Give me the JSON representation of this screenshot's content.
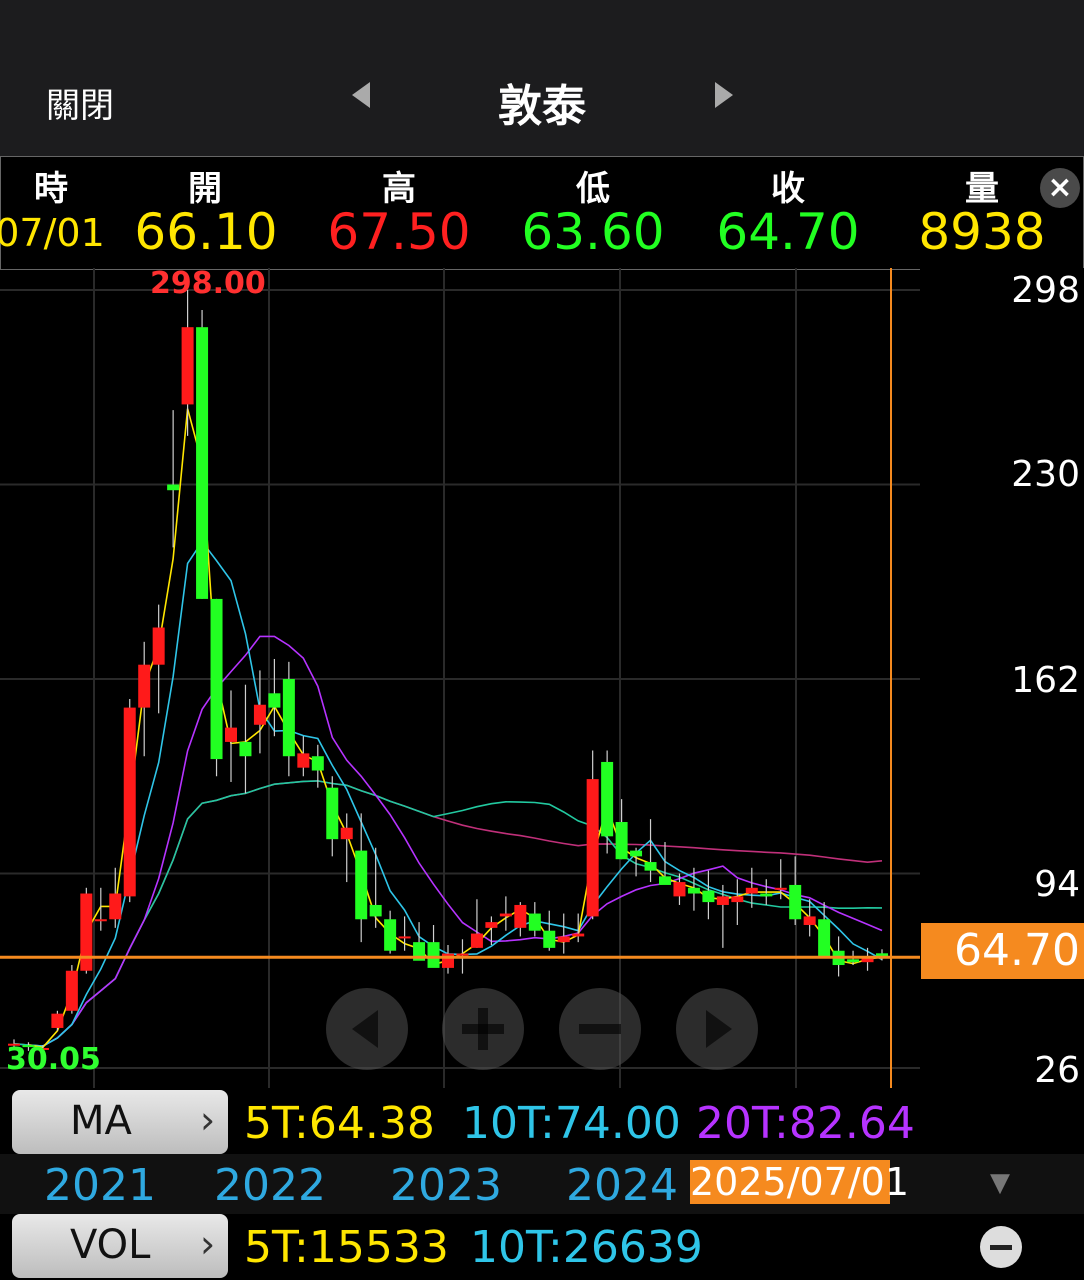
{
  "header": {
    "close_label": "關閉",
    "title": "敦泰"
  },
  "quote": {
    "headers": [
      "時",
      "開",
      "高",
      "低",
      "收",
      "量"
    ],
    "date": "07/01",
    "open": "66.10",
    "high": "67.50",
    "low": "63.60",
    "close": "64.70",
    "volume": "8938"
  },
  "chart_data": {
    "type": "candlestick",
    "ylim": [
      26,
      298
    ],
    "y_ticks": [
      "298",
      "230",
      "162",
      "94",
      "26"
    ],
    "max_label": "298.00",
    "min_label": "30.05",
    "current_price_label": "64.70",
    "x_labels": [
      "2021",
      "2022",
      "2023",
      "2024"
    ],
    "cursor_date": "2025/07/01",
    "colors": {
      "up": "#ff1a1a",
      "down": "#22ff22",
      "ma5": "#ffe600",
      "ma10": "#2fc5e8",
      "ma20": "#b633ff",
      "ma60": "#22c9a0",
      "ma120": "#c0307a",
      "cursor": "#f58a1f"
    },
    "candles": [
      [
        34,
        36,
        33,
        34.5
      ],
      [
        34,
        35,
        32,
        33.5
      ],
      [
        33,
        34,
        31,
        33
      ],
      [
        40,
        46,
        39,
        45
      ],
      [
        46,
        62,
        45,
        60
      ],
      [
        60,
        89,
        59,
        87
      ],
      [
        78,
        89,
        74,
        78
      ],
      [
        78,
        96,
        75,
        87
      ],
      [
        86,
        155,
        84,
        152
      ],
      [
        152,
        175,
        135,
        167
      ],
      [
        167,
        188,
        150,
        180
      ],
      [
        230,
        256,
        208,
        228
      ],
      [
        258,
        298,
        247,
        285
      ],
      [
        285,
        291,
        190,
        190
      ],
      [
        190,
        190,
        128,
        134
      ],
      [
        140,
        158,
        126,
        145
      ],
      [
        140,
        160,
        122,
        135
      ],
      [
        146,
        165,
        136,
        153
      ],
      [
        157,
        169,
        142,
        152
      ],
      [
        162,
        168,
        128,
        135
      ],
      [
        131,
        142,
        128,
        136
      ],
      [
        135,
        139,
        124,
        130
      ],
      [
        124,
        128,
        100,
        106
      ],
      [
        106,
        115,
        91,
        110
      ],
      [
        102,
        115,
        70,
        78
      ],
      [
        83,
        103,
        75,
        79
      ],
      [
        78,
        81,
        66,
        67
      ],
      [
        72,
        79,
        67,
        72
      ],
      [
        70,
        77,
        64,
        63.5
      ],
      [
        70,
        76,
        64,
        61
      ],
      [
        61,
        69,
        59,
        66
      ],
      [
        66,
        71,
        59,
        66
      ],
      [
        68,
        85,
        68,
        73
      ],
      [
        75,
        79,
        69,
        77
      ],
      [
        79,
        86,
        74,
        80
      ],
      [
        75,
        84,
        72,
        83
      ],
      [
        80,
        84,
        72,
        74
      ],
      [
        74,
        81,
        67,
        68
      ],
      [
        70,
        80,
        66,
        72
      ],
      [
        72,
        80,
        70,
        73
      ],
      [
        79,
        137,
        78,
        127
      ],
      [
        133,
        137,
        101,
        107
      ],
      [
        112,
        120,
        99,
        99
      ],
      [
        102,
        103,
        93,
        100
      ],
      [
        98,
        113,
        91,
        95
      ],
      [
        93,
        105,
        91,
        90
      ],
      [
        86,
        94,
        83,
        91
      ],
      [
        89,
        96,
        81,
        87
      ],
      [
        88,
        95,
        78,
        84
      ],
      [
        83,
        90,
        68,
        86
      ],
      [
        84,
        92,
        76,
        86
      ],
      [
        87,
        96,
        82,
        89
      ],
      [
        87,
        92,
        83,
        86
      ],
      [
        89,
        99,
        85,
        89
      ],
      [
        90,
        100,
        76,
        78
      ],
      [
        76,
        85,
        72,
        79
      ],
      [
        78,
        84,
        72,
        65
      ],
      [
        67,
        72,
        58,
        62
      ],
      [
        64,
        67,
        62,
        63
      ],
      [
        63,
        68,
        60,
        65
      ],
      [
        66.1,
        67.5,
        63.6,
        64.7
      ]
    ]
  },
  "ma": {
    "button_label": "MA",
    "t5": "5T:64.38",
    "t10": "10T:74.00",
    "t20": "20T:82.64"
  },
  "vol": {
    "button_label": "VOL",
    "t5": "5T:15533",
    "t10": "10T:26639"
  }
}
